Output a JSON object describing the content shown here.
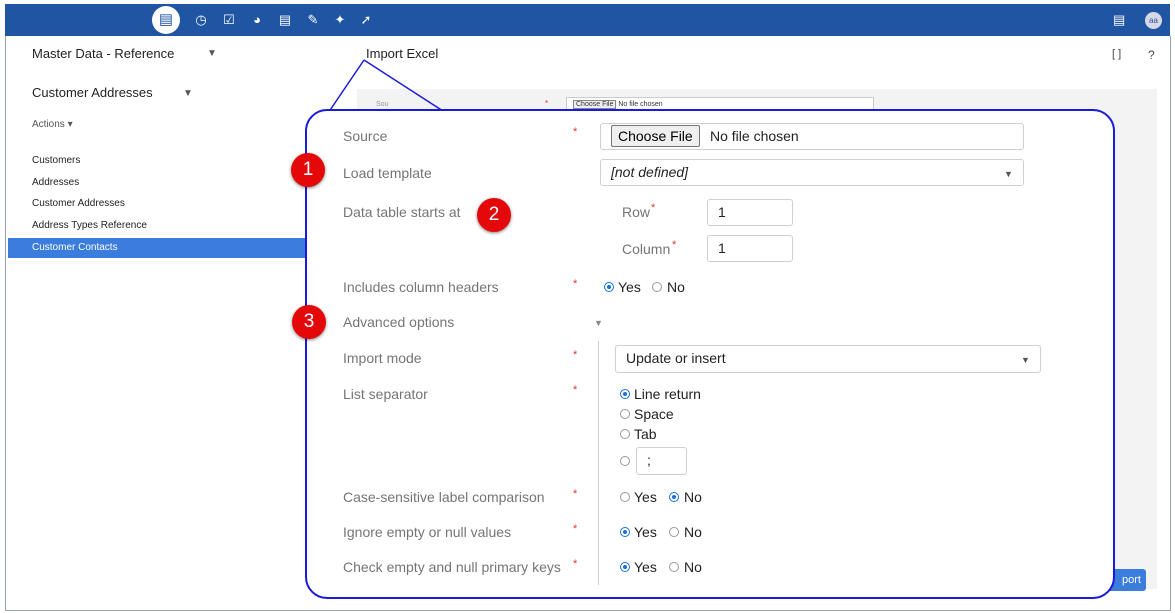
{
  "topbar": {
    "icons": [
      "database-icon",
      "clock-icon",
      "checkbox-icon",
      "gauge-icon",
      "document-icon",
      "edit-check-icon",
      "plug-icon",
      "wrench-icon"
    ],
    "right_icons": [
      "list-icon"
    ],
    "avatar": "aa",
    "bg_color": "#1f55a3"
  },
  "sidebar": {
    "title": "Master Data - Reference",
    "subtitle": "Customer Addresses",
    "actions": "Actions ▾",
    "items": [
      {
        "label": "Customers"
      },
      {
        "label": "Addresses"
      },
      {
        "label": "Customer Addresses"
      },
      {
        "label": "Address Types Reference"
      },
      {
        "label": "Customer Contacts"
      }
    ],
    "selected_color": "#3b7ddd"
  },
  "main": {
    "title": "Import Excel",
    "background_form": {
      "source_label": "Sou",
      "file_button": "Choose File",
      "file_text": "No file chosen"
    },
    "import_button": "port"
  },
  "callout": {
    "border_color": "#1a1adc",
    "badges": [
      "1",
      "2",
      "3"
    ],
    "form": {
      "source": {
        "label": "Source",
        "button": "Choose File",
        "file_text": "No file chosen"
      },
      "load_template": {
        "label": "Load template",
        "value": "[not defined]"
      },
      "data_table": {
        "label": "Data table starts at",
        "row_label": "Row",
        "row_value": "1",
        "column_label": "Column",
        "column_value": "1"
      },
      "column_headers": {
        "label": "Includes column headers",
        "yes": "Yes",
        "no": "No"
      },
      "advanced": {
        "label": "Advanced options"
      },
      "import_mode": {
        "label": "Import mode",
        "value": "Update or insert"
      },
      "list_separator": {
        "label": "List separator",
        "options": [
          "Line return",
          "Space",
          "Tab"
        ],
        "custom_value": ";"
      },
      "case_sensitive": {
        "label": "Case-sensitive label comparison",
        "yes": "Yes",
        "no": "No"
      },
      "ignore_empty": {
        "label": "Ignore empty or null values",
        "yes": "Yes",
        "no": "No"
      },
      "check_keys": {
        "label": "Check empty and null primary keys",
        "yes": "Yes",
        "no": "No"
      }
    }
  }
}
